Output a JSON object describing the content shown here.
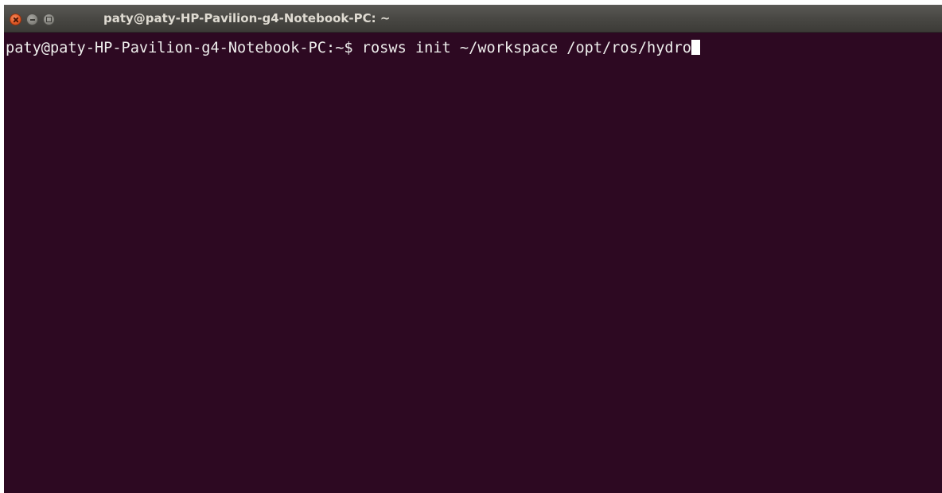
{
  "window": {
    "title": "paty@paty-HP-Pavilion-g4-Notebook-PC: ~"
  },
  "window_controls": [
    {
      "icon": "close-icon",
      "color": "#e25a27"
    },
    {
      "icon": "minimize-icon",
      "color": "#86857f"
    },
    {
      "icon": "maximize-icon",
      "color": "#86857f"
    }
  ],
  "terminal": {
    "prompt": "paty@paty-HP-Pavilion-g4-Notebook-PC:~$",
    "command": "rosws init ~/workspace /opt/ros/hydro",
    "background_color": "#2d0922",
    "text_color": "#eeeeec"
  }
}
